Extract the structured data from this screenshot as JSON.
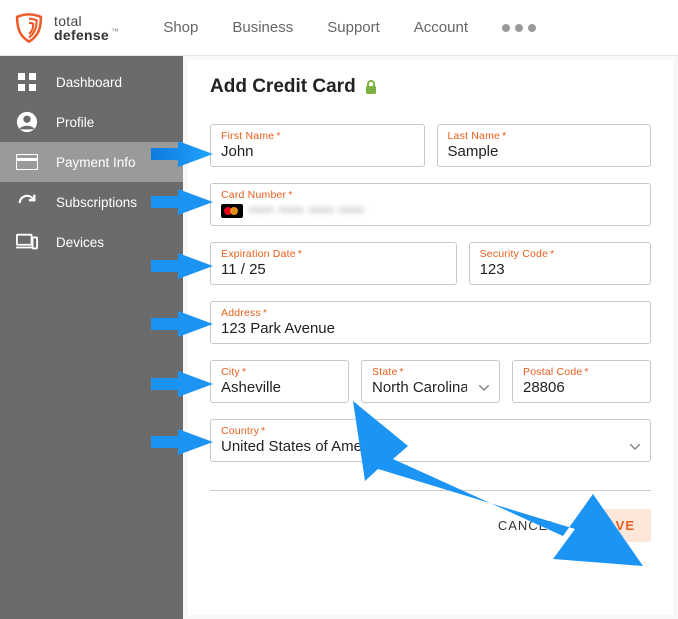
{
  "brand": {
    "line1": "total",
    "line2": "defense"
  },
  "topnav": {
    "shop": "Shop",
    "business": "Business",
    "support": "Support",
    "account": "Account"
  },
  "sidebar": {
    "items": [
      {
        "label": "Dashboard"
      },
      {
        "label": "Profile"
      },
      {
        "label": "Payment Info"
      },
      {
        "label": "Subscriptions"
      },
      {
        "label": "Devices"
      }
    ]
  },
  "page": {
    "title": "Add Credit Card"
  },
  "form": {
    "first_name": {
      "label": "First Name",
      "value": "John"
    },
    "last_name": {
      "label": "Last Name",
      "value": "Sample"
    },
    "card_number": {
      "label": "Card Number",
      "value": "•••• •••• •••• ••••"
    },
    "exp": {
      "label": "Expiration Date",
      "value": "11 / 25"
    },
    "cvv": {
      "label": "Security Code",
      "value": "123"
    },
    "address": {
      "label": "Address",
      "value": "123 Park Avenue"
    },
    "city": {
      "label": "City",
      "value": "Asheville"
    },
    "state": {
      "label": "State",
      "value": "North Carolina"
    },
    "postal": {
      "label": "Postal Code",
      "value": "28806"
    },
    "country": {
      "label": "Country",
      "value": "United States of America"
    }
  },
  "actions": {
    "cancel": "CANCEL",
    "save": "SAVE"
  }
}
